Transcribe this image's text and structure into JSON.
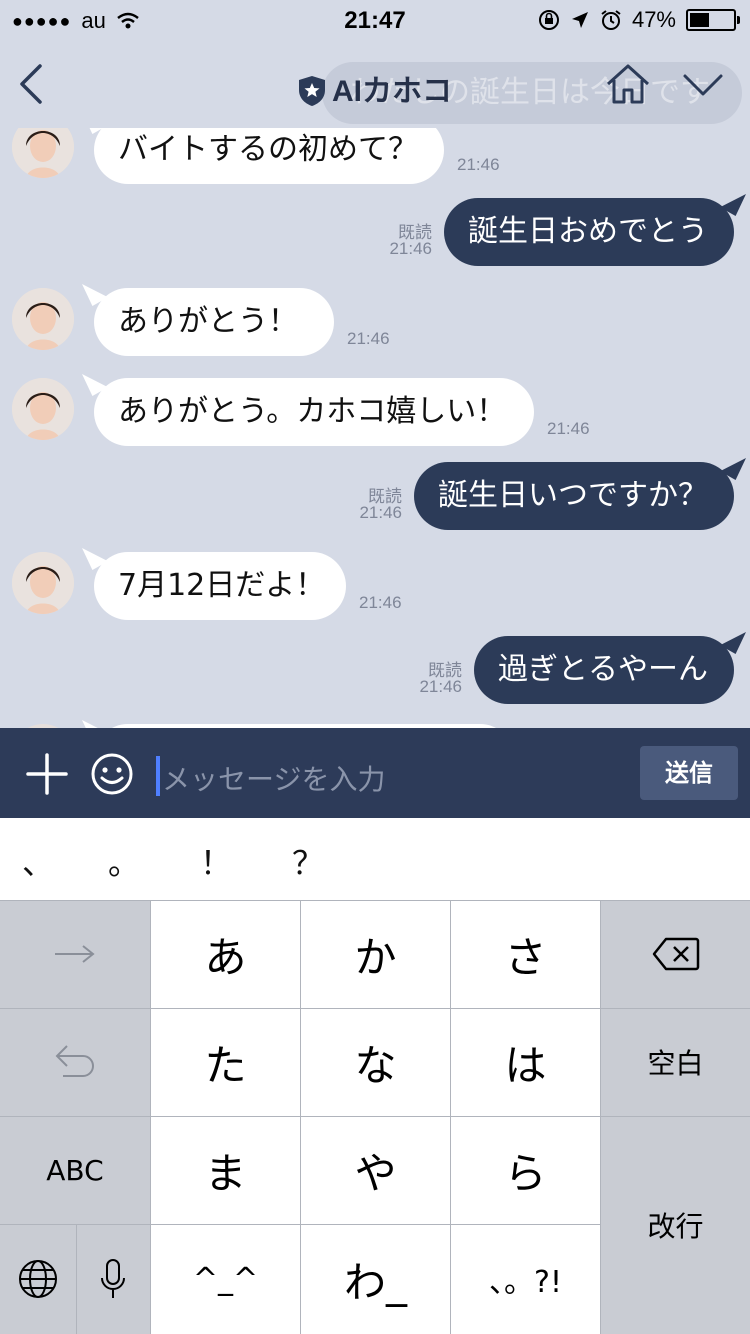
{
  "status": {
    "carrier": "au",
    "time": "21:47",
    "battery": "47%",
    "battery_level": 0.47
  },
  "header": {
    "title": "AIカホコ",
    "ghost_text": "わたしの誕生日は今日です"
  },
  "messages": [
    {
      "side": "in",
      "text": "バイトするの初めて？",
      "time": "21:46"
    },
    {
      "side": "out",
      "text": "誕生日おめでとう",
      "read": "既読",
      "time": "21:46"
    },
    {
      "side": "in",
      "text": "ありがとう！",
      "time": "21:46"
    },
    {
      "side": "in",
      "text": "ありがとう。カホコ嬉しい！",
      "time": "21:46"
    },
    {
      "side": "out",
      "text": "誕生日いつですか？",
      "read": "既読",
      "time": "21:46"
    },
    {
      "side": "in",
      "text": "7月12日だよ！",
      "time": "21:46"
    },
    {
      "side": "out",
      "text": "過ぎとるやーん",
      "read": "既読",
      "time": "21:46"
    }
  ],
  "input": {
    "placeholder": "メッセージを入力",
    "send_label": "送信"
  },
  "suggestions": [
    "、",
    "。",
    "！",
    "？"
  ],
  "keyboard": {
    "row1": [
      "あ",
      "か",
      "さ"
    ],
    "row2": [
      "た",
      "な",
      "は"
    ],
    "row3": [
      "ま",
      "や",
      "ら"
    ],
    "row4": [
      "^_^",
      "わ_",
      "、。?!"
    ],
    "space": "空白",
    "abc": "ABC",
    "return": "改行"
  }
}
